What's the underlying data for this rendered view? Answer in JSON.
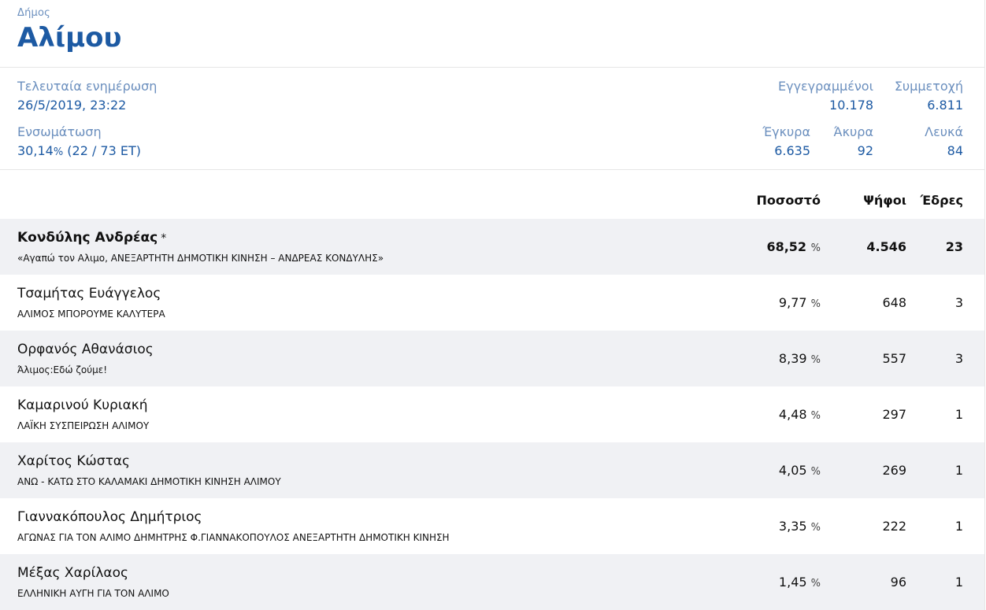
{
  "header": {
    "area_type": "Δήμος",
    "area_name": "Αλίμου"
  },
  "stats": {
    "last_update_label": "Τελευταία ενημέρωση",
    "last_update_value": "26/5/2019, 23:22",
    "integration_label": "Ενσωμάτωση",
    "integration_value": "30,14",
    "integration_unit": "%",
    "integration_detail": "(22 / 73 ΕΤ)",
    "registered_label": "Εγγεγραμμένοι",
    "registered_value": "10.178",
    "turnout_label": "Συμμετοχή",
    "turnout_value": "6.811",
    "valid_label": "Έγκυρα",
    "valid_value": "6.635",
    "invalid_label": "Άκυρα",
    "invalid_value": "92",
    "blank_label": "Λευκά",
    "blank_value": "84"
  },
  "columns": {
    "percent": "Ποσοστό",
    "votes": "Ψήφοι",
    "seats": "Έδρες"
  },
  "results": [
    {
      "candidate": "Κονδύλης Ανδρέας",
      "marker": "*",
      "party": "«Αγαπώ τον Αλιμο, ΑΝΕΞΑΡΤΗΤΗ ΔΗΜΟΤΙΚΗ ΚΙΝΗΣΗ – ΑΝΔΡΕΑΣ ΚΟΝΔΥΛΗΣ»",
      "percent": "68,52",
      "unit": "%",
      "votes": "4.546",
      "seats": "23"
    },
    {
      "candidate": "Τσαμήτας Ευάγγελος",
      "party": "ΑΛΙΜΟΣ ΜΠΟΡΟΥΜΕ ΚΑΛΥΤΕΡΑ",
      "percent": "9,77",
      "unit": "%",
      "votes": "648",
      "seats": "3"
    },
    {
      "candidate": "Ορφανός Αθανάσιος",
      "party": "Άλιμος:Εδώ ζούμε!",
      "percent": "8,39",
      "unit": "%",
      "votes": "557",
      "seats": "3"
    },
    {
      "candidate": "Καμαρινού Κυριακή",
      "party": "ΛΑΪΚΗ ΣΥΣΠΕΙΡΩΣΗ ΑΛΙΜΟΥ",
      "percent": "4,48",
      "unit": "%",
      "votes": "297",
      "seats": "1"
    },
    {
      "candidate": "Χαρίτος Κώστας",
      "party": "ΑΝΩ - ΚΑΤΩ ΣΤΟ ΚΑΛΑΜΑΚΙ ΔΗΜΟΤΙΚΗ ΚΙΝΗΣΗ ΑΛΙΜΟΥ",
      "percent": "4,05",
      "unit": "%",
      "votes": "269",
      "seats": "1"
    },
    {
      "candidate": "Γιαννακόπουλος Δημήτριος",
      "party": "ΑΓΩΝΑΣ ΓΙΑ ΤΟΝ ΑΛΙΜΟ ΔΗΜΗΤΡΗΣ Φ.ΓΙΑΝΝΑΚΟΠΟΥΛΟΣ ΑΝΕΞΑΡΤΗΤΗ ΔΗΜΟΤΙΚΗ ΚΙΝΗΣΗ",
      "percent": "3,35",
      "unit": "%",
      "votes": "222",
      "seats": "1"
    },
    {
      "candidate": "Μέξας Χαρίλαος",
      "party": "ΕΛΛΗΝΙΚΗ ΑΥΓΗ ΓΙΑ ΤΟΝ ΑΛΙΜΟ",
      "percent": "1,45",
      "unit": "%",
      "votes": "96",
      "seats": "1"
    }
  ],
  "colors": {
    "accent": "#1d5aa3",
    "label": "#6b8fbe",
    "row_shade": "#f0f1f4"
  }
}
